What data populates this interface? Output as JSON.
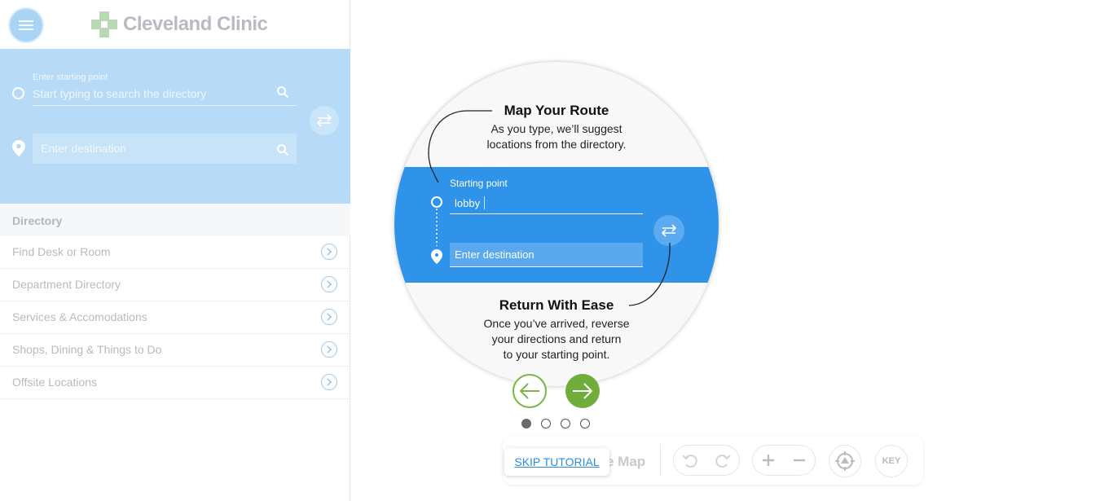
{
  "header": {
    "logo_text": "Cleveland Clinic",
    "menu_icon": "hamburger-icon"
  },
  "search": {
    "start_label": "Enter starting point",
    "start_placeholder": "Start typing to search the directory",
    "destination_placeholder": "Enter destination"
  },
  "directory": {
    "title": "Directory",
    "items": [
      {
        "label": "Find Desk or Room"
      },
      {
        "label": "Department Directory"
      },
      {
        "label": "Services & Accomodations"
      },
      {
        "label": "Shops, Dining & Things to Do"
      },
      {
        "label": "Offsite Locations"
      }
    ]
  },
  "tutorial": {
    "title1": "Map Your Route",
    "text1_line1": "As you type, we’ll suggest",
    "text1_line2": "locations from the directory.",
    "start_label": "Starting point",
    "start_value": "lobby",
    "destination_placeholder": "Enter destination",
    "title2": "Return With Ease",
    "text2_line1": "Once you’ve arrived, reverse",
    "text2_line2": "your directions and return",
    "text2_line3": "to your starting point.",
    "current_page": 1,
    "total_pages": 4
  },
  "toolbar": {
    "map_label_partial": "e Map",
    "key_label": "KEY",
    "skip_label": "SKIP TUTORIAL"
  },
  "colors": {
    "accent_blue": "#2f93ea",
    "panel_blue": "#b7dbf6",
    "nav_green": "#6fae3a"
  }
}
